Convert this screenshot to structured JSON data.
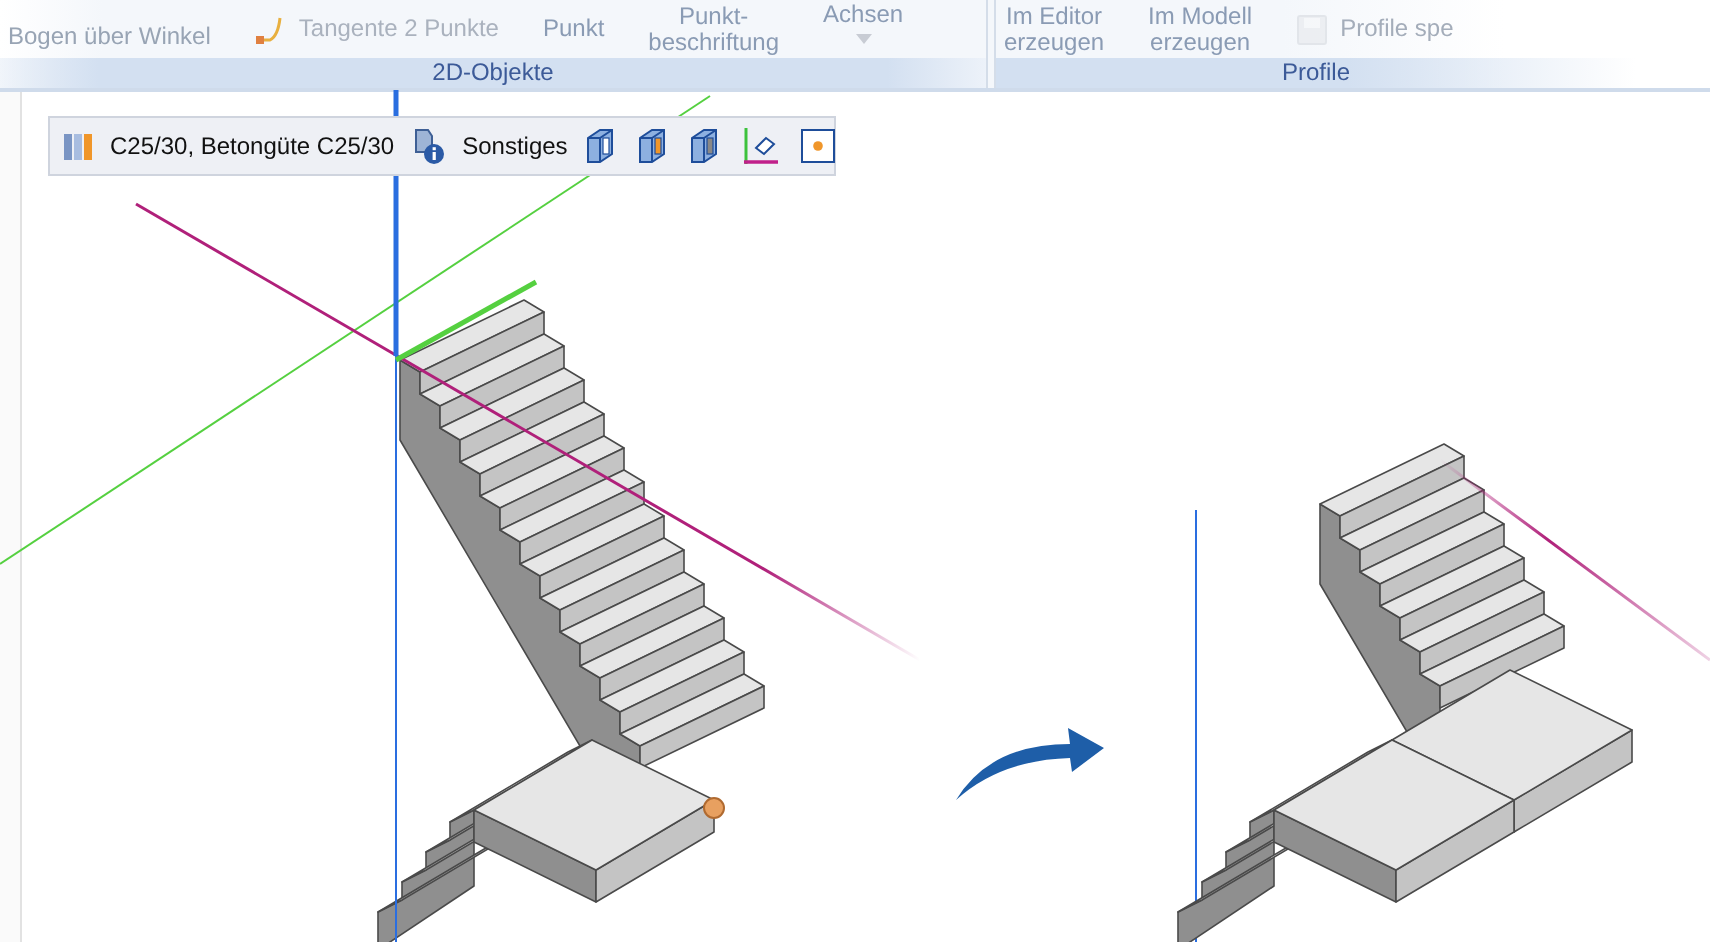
{
  "ribbon": {
    "groups": [
      {
        "label": "2D-Objekte",
        "items": [
          {
            "kind": "text",
            "lines": [
              "Bogen über Winkel"
            ]
          },
          {
            "kind": "icon-text",
            "lines": [
              "Tangente 2 Punkte"
            ]
          },
          {
            "kind": "text",
            "lines": [
              "Punkt"
            ]
          },
          {
            "kind": "text",
            "lines": [
              "Punkt-",
              "beschriftung"
            ]
          },
          {
            "kind": "dropdown",
            "lines": [
              "Achsen"
            ]
          }
        ]
      },
      {
        "label": "Profile",
        "items": [
          {
            "kind": "text",
            "lines": [
              "Im Editor",
              "erzeugen"
            ]
          },
          {
            "kind": "text",
            "lines": [
              "Im Modell",
              "erzeugen"
            ]
          },
          {
            "kind": "icon-text",
            "lines": [
              "Profile spe"
            ]
          }
        ]
      }
    ]
  },
  "toolbar": {
    "items": [
      {
        "kind": "icon"
      },
      {
        "kind": "text",
        "label": "C25/30, Betongüte C25/30"
      },
      {
        "kind": "icon"
      },
      {
        "kind": "text",
        "label": "Sonstiges"
      },
      {
        "kind": "icon"
      },
      {
        "kind": "icon"
      },
      {
        "kind": "icon"
      },
      {
        "kind": "icon"
      },
      {
        "kind": "icon"
      }
    ]
  }
}
